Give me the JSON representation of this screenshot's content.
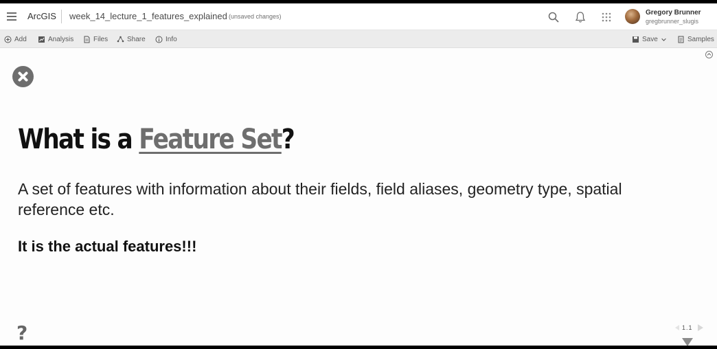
{
  "header": {
    "brand": "ArcGIS",
    "notebook_title": "week_14_lecture_1_features_explained",
    "status": "(unsaved changes)",
    "user": {
      "name": "Gregory Brunner",
      "handle": "gregbrunner_slugis"
    },
    "icons": [
      "menu-icon",
      "search-icon",
      "bell-icon",
      "apps-grid-icon",
      "avatar"
    ]
  },
  "toolbar": {
    "items": [
      {
        "label": "Add",
        "icon": "add-circle-icon"
      },
      {
        "label": "Analysis",
        "icon": "analysis-icon"
      },
      {
        "label": "Files",
        "icon": "file-icon"
      },
      {
        "label": "Share",
        "icon": "share-icon"
      },
      {
        "label": "Info",
        "icon": "info-icon"
      }
    ],
    "right_items": [
      {
        "label": "Save",
        "icon": "save-icon"
      },
      {
        "label": "Samples",
        "icon": "samples-icon"
      }
    ]
  },
  "slide": {
    "title_prefix": "What is a ",
    "title_link": "Feature Set",
    "title_suffix": "?",
    "body": "A set of features with information about their fields, field aliases, geometry type, spatial reference etc.",
    "emphasis": "It is the actual features!!!",
    "help": "?",
    "slide_number": "1.1"
  },
  "colors": {
    "header_bg": "#ffffff",
    "toolbar_bg": "#ececec",
    "link": "#6e6e6e",
    "text": "#111111"
  }
}
